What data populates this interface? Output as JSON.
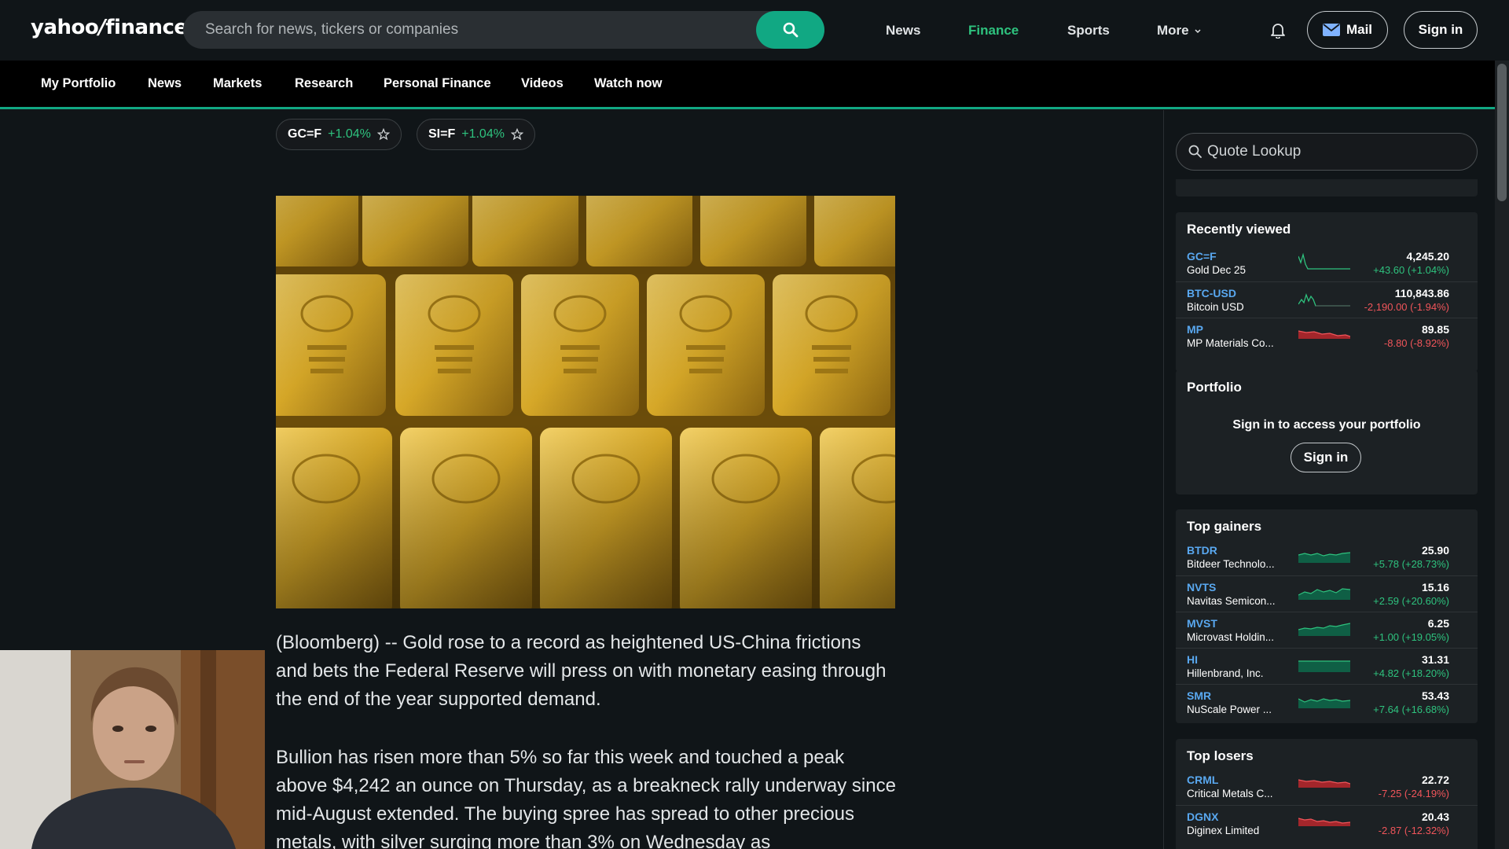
{
  "header": {
    "logo_main": "yahoo",
    "logo_slash": "/",
    "logo_sub": "finance",
    "search_placeholder": "Search for news, tickers or companies",
    "nav": [
      {
        "label": "News",
        "active": false
      },
      {
        "label": "Finance",
        "active": true
      },
      {
        "label": "Sports",
        "active": false
      },
      {
        "label": "More",
        "active": false
      }
    ],
    "mail_label": "Mail",
    "signin_label": "Sign in",
    "icons": {
      "search": "search-icon",
      "bell": "bell-icon",
      "mail": "mail-icon",
      "chevron": "chevron-down-icon"
    },
    "accent_color": "#11a883"
  },
  "subnav": [
    "My Portfolio",
    "News",
    "Markets",
    "Research",
    "Personal Finance",
    "Videos",
    "Watch now"
  ],
  "tickers": [
    {
      "symbol": "GC=F",
      "change": "+1.04%"
    },
    {
      "symbol": "SI=F",
      "change": "+1.04%"
    }
  ],
  "article": {
    "image_subject": "gold bars",
    "paragraphs": [
      "(Bloomberg) -- Gold rose to a record as heightened US-China frictions and bets the Federal Reserve will press on with monetary easing through the end of the year supported demand.",
      "Bullion has risen more than 5% so far this week and touched a peak above $4,242 an ounce on Thursday, as a breakneck rally underway since mid-August extended. The buying spree has spread to other precious metals, with silver surging more than 3% on Wednesday as"
    ]
  },
  "sidebar": {
    "quote_placeholder": "Quote Lookup",
    "recently_viewed": {
      "title": "Recently viewed",
      "items": [
        {
          "symbol": "GC=F",
          "name": "Gold Dec 25",
          "price": "4,245.20",
          "change": "+43.60 (+1.04%)",
          "dir": "up"
        },
        {
          "symbol": "BTC-USD",
          "name": "Bitcoin USD",
          "price": "110,843.86",
          "change": "-2,190.00 (-1.94%)",
          "dir": "up"
        },
        {
          "symbol": "MP",
          "name": "MP Materials Co...",
          "price": "89.85",
          "change": "-8.80 (-8.92%)",
          "dir": "down"
        }
      ]
    },
    "portfolio": {
      "title": "Portfolio",
      "message": "Sign in to access your portfolio",
      "button": "Sign in"
    },
    "top_gainers": {
      "title": "Top gainers",
      "items": [
        {
          "symbol": "BTDR",
          "name": "Bitdeer Technolo...",
          "price": "25.90",
          "change": "+5.78 (+28.73%)",
          "dir": "up"
        },
        {
          "symbol": "NVTS",
          "name": "Navitas Semicon...",
          "price": "15.16",
          "change": "+2.59 (+20.60%)",
          "dir": "up"
        },
        {
          "symbol": "MVST",
          "name": "Microvast Holdin...",
          "price": "6.25",
          "change": "+1.00 (+19.05%)",
          "dir": "up"
        },
        {
          "symbol": "HI",
          "name": "Hillenbrand, Inc.",
          "price": "31.31",
          "change": "+4.82 (+18.20%)",
          "dir": "up"
        },
        {
          "symbol": "SMR",
          "name": "NuScale Power ...",
          "price": "53.43",
          "change": "+7.64 (+16.68%)",
          "dir": "up"
        }
      ]
    },
    "top_losers": {
      "title": "Top losers",
      "items": [
        {
          "symbol": "CRML",
          "name": "Critical Metals C...",
          "price": "22.72",
          "change": "-7.25 (-24.19%)",
          "dir": "down"
        },
        {
          "symbol": "DGNX",
          "name": "Diginex Limited",
          "price": "20.43",
          "change": "-2.87 (-12.32%)",
          "dir": "down"
        }
      ]
    },
    "colors": {
      "up": "#2ec27e",
      "down": "#f0555a",
      "symbol": "#59a8f0"
    }
  }
}
